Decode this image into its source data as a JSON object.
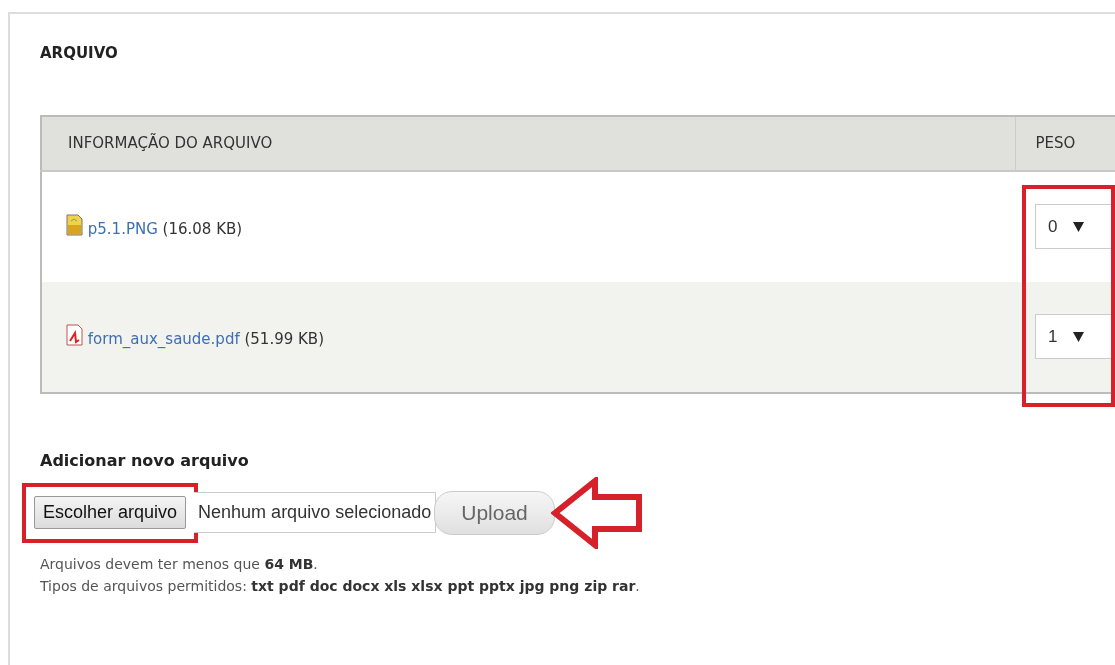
{
  "fieldset": {
    "legend": "ARQUIVO"
  },
  "table": {
    "columns": [
      "INFORMAÇÃO DO ARQUIVO",
      "PESO"
    ],
    "rows": [
      {
        "kind": "image",
        "name": "p5.1.PNG",
        "size": "(16.08 KB)",
        "weight": "0"
      },
      {
        "kind": "pdf",
        "name": "form_aux_saude.pdf",
        "size": "(51.99 KB)",
        "weight": "1"
      }
    ]
  },
  "upload": {
    "label": "Adicionar novo arquivo",
    "choose_button": "Escolher arquivo",
    "no_file": "Nenhum arquivo selecionado",
    "upload_button": "Upload",
    "help": [
      "Arquivos devem ter menos que **64 MB**.",
      "Tipos de arquivos permitidos: **txt pdf doc docx xls xlsx ppt pptx jpg png zip rar**."
    ]
  }
}
